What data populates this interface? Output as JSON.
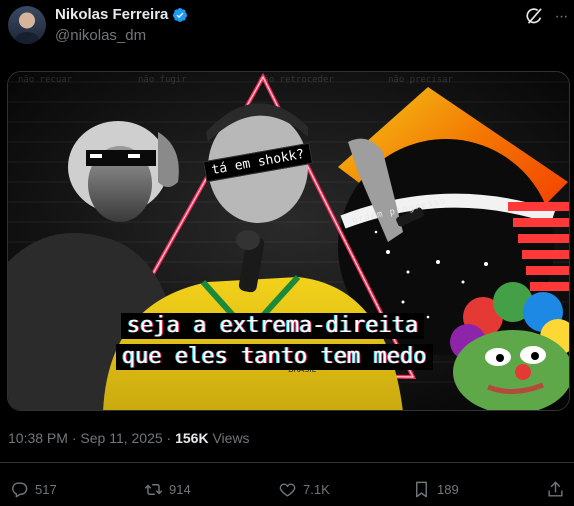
{
  "author": {
    "display_name": "Nikolas Ferreira",
    "handle": "@nikolas_dm"
  },
  "icons": {
    "verified": "verified-badge-icon",
    "grok": "grok-icon",
    "more": "more-icon",
    "reply": "reply-icon",
    "repost": "repost-icon",
    "like": "heart-icon",
    "bookmark": "bookmark-icon",
    "share": "share-icon"
  },
  "colors": {
    "verified": "#1d9bf0",
    "muted": "#71767b",
    "text": "#e7e9ea",
    "border": "#2f3336"
  },
  "media": {
    "sticker": "tá em shokk?",
    "caption_line1": "seja a extrema-direita",
    "caption_line2": "que eles tanto tem medo",
    "orb_text": "ordem  progresso",
    "shirt_text": "BRASIL",
    "background_phrases": [
      "não recuar",
      "não fugir",
      "não retroceder",
      "não precisar"
    ]
  },
  "meta": {
    "time": "10:38 PM",
    "separator": " · ",
    "date": "Sep 11, 2025",
    "views_count": "156K",
    "views_label": " Views"
  },
  "actions": {
    "replies": "517",
    "reposts": "914",
    "likes": "7.1K",
    "bookmarks": "189"
  }
}
